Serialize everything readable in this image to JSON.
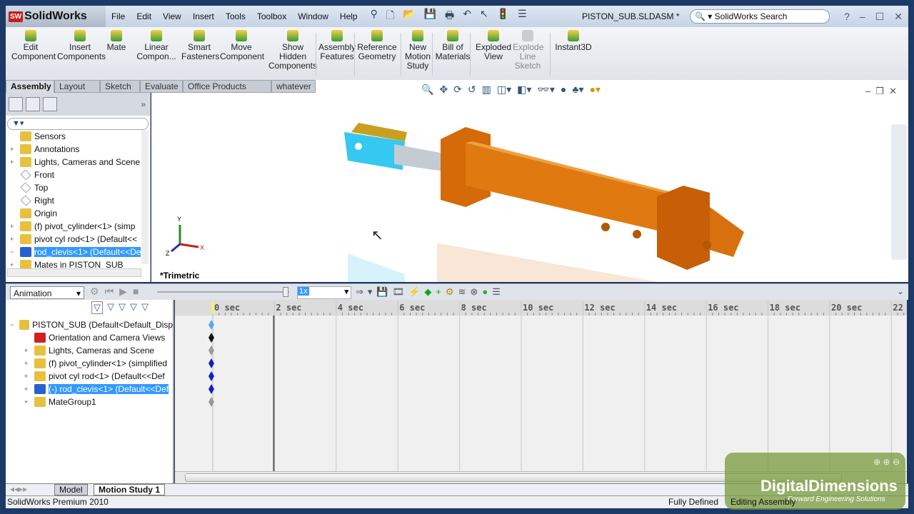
{
  "app": {
    "name": "SolidWorks",
    "document_title": "PISTON_SUB.SLDASM *",
    "search_placeholder": "SolidWorks Search"
  },
  "menu": [
    "File",
    "Edit",
    "View",
    "Insert",
    "Tools",
    "Toolbox",
    "Window",
    "Help"
  ],
  "command_manager": [
    {
      "label": "Edit\nComponent",
      "icon": "edit-component-icon"
    },
    {
      "label": "Insert\nComponents",
      "icon": "insert-components-icon"
    },
    {
      "label": "Mate",
      "icon": "paperclip-icon"
    },
    {
      "label": "Linear\nCompon...",
      "icon": "linear-pattern-icon"
    },
    {
      "label": "Smart\nFasteners",
      "icon": "smart-fasteners-icon"
    },
    {
      "label": "Move\nComponent",
      "icon": "move-component-icon"
    },
    {
      "label": "Show\nHidden\nComponents",
      "icon": "show-hidden-icon"
    },
    {
      "label": "Assembly\nFeatures",
      "icon": "assembly-features-icon"
    },
    {
      "label": "Reference\nGeometry",
      "icon": "reference-geometry-icon"
    },
    {
      "label": "New\nMotion\nStudy",
      "icon": "motion-study-icon"
    },
    {
      "label": "Bill of\nMaterials",
      "icon": "bom-icon"
    },
    {
      "label": "Exploded\nView",
      "icon": "exploded-view-icon"
    },
    {
      "label": "Explode\nLine\nSketch",
      "icon": "explode-line-icon",
      "disabled": true
    },
    {
      "label": "Instant3D",
      "icon": "instant3d-icon"
    }
  ],
  "tabs": [
    "Assembly",
    "Layout",
    "Sketch",
    "Evaluate",
    "Office Products",
    "whatever"
  ],
  "active_tab": "Assembly",
  "feature_tree": [
    {
      "label": "Sensors",
      "icon": "sensor-folder-icon",
      "expander": ""
    },
    {
      "label": "Annotations",
      "icon": "annotations-icon",
      "expander": "+"
    },
    {
      "label": "Lights, Cameras and Scene",
      "icon": "lights-folder-icon",
      "expander": "+"
    },
    {
      "label": "Front",
      "icon": "plane-icon",
      "expander": ""
    },
    {
      "label": "Top",
      "icon": "plane-icon",
      "expander": ""
    },
    {
      "label": "Right",
      "icon": "plane-icon",
      "expander": ""
    },
    {
      "label": "Origin",
      "icon": "origin-icon",
      "expander": ""
    },
    {
      "label": "(f) pivot_cylinder<1> (simp",
      "icon": "part-icon",
      "expander": "+"
    },
    {
      "label": "pivot cyl rod<1> (Default<<",
      "icon": "part-icon",
      "expander": "+"
    },
    {
      "label": "rod_clevis<1> (Default<<De",
      "icon": "part-icon",
      "expander": "−",
      "selected": true
    },
    {
      "label": "Mates in PISTON_SUB",
      "icon": "mates-folder-icon",
      "expander": "+"
    }
  ],
  "viewport": {
    "view_name": "*Trimetric",
    "axes": {
      "x": "X",
      "y": "Y",
      "z": "Z"
    }
  },
  "motion": {
    "study_type": "Animation",
    "playback_rate": "1x",
    "time_labels": [
      "0 sec",
      "2 sec",
      "4 sec",
      "6 sec",
      "8 sec",
      "10 sec",
      "12 sec",
      "14 sec",
      "16 sec",
      "18 sec",
      "20 sec",
      "22"
    ],
    "tree": [
      {
        "label": "PISTON_SUB  (Default<Default_Disp",
        "expander": "−",
        "key_color": "#5aa8f0"
      },
      {
        "label": "Orientation and Camera Views",
        "expander": "",
        "key_color": "#111111"
      },
      {
        "label": "Lights, Cameras and Scene",
        "expander": "+",
        "key_color": "#999999"
      },
      {
        "label": "(f) pivot_cylinder<1> (simplified",
        "expander": "+",
        "key_color": "#1020c0"
      },
      {
        "label": "pivot cyl rod<1> (Default<<Def",
        "expander": "+",
        "key_color": "#1020c0"
      },
      {
        "label": "(-) rod_clevis<1> (Default<<Def",
        "expander": "+",
        "key_color": "#1020c0",
        "selected": true
      },
      {
        "label": "MateGroup1",
        "expander": "+",
        "key_color": "#999999"
      }
    ]
  },
  "bottom_tabs": [
    "Model",
    "Motion Study 1"
  ],
  "status": {
    "left": "SolidWorks Premium 2010",
    "state": "Fully Defined",
    "mode": "Editing Assembly"
  },
  "watermark": {
    "brand": "DigitalDimensions",
    "tagline": "Forward Engineering Solutions"
  },
  "colors": {
    "selection": "#3399ff",
    "part": "#e07a10",
    "clevis": "#35c8f0"
  }
}
